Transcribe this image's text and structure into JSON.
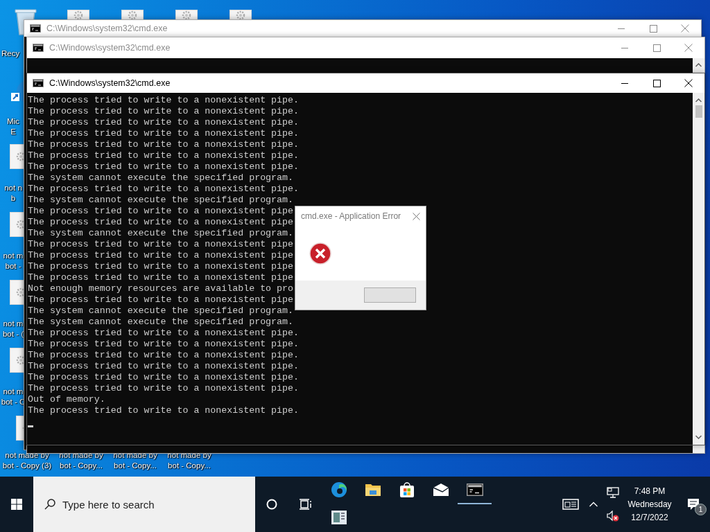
{
  "desktop": {
    "left_icons": [
      {
        "kind": "recycle",
        "label_lines": [
          "Recy"
        ]
      },
      {
        "kind": "edge",
        "label_lines": [
          "Mic",
          "E"
        ]
      },
      {
        "kind": "file",
        "label_lines": [
          "not n",
          "b"
        ]
      },
      {
        "kind": "file",
        "label_lines": [
          "not m",
          "bot -"
        ]
      },
      {
        "kind": "file",
        "label_lines": [
          "not m",
          "bot - ("
        ]
      },
      {
        "kind": "file",
        "label_lines": [
          "not m",
          "bot - C"
        ]
      }
    ],
    "top_icons": [
      {
        "kind": "file"
      },
      {
        "kind": "file"
      },
      {
        "kind": "file"
      },
      {
        "kind": "file"
      }
    ],
    "bottom_icons": [
      {
        "kind": "file",
        "label_lines": [
          "not made by",
          "bot - Copy (3)"
        ]
      },
      {
        "kind": "hidden",
        "label_lines": [
          "not made by",
          "bot - Copy..."
        ]
      },
      {
        "kind": "hidden",
        "label_lines": [
          "not made by",
          "bot - Copy..."
        ]
      },
      {
        "kind": "hidden",
        "label_lines": [
          "not made by",
          "bot - Copy..."
        ]
      }
    ]
  },
  "windows": [
    {
      "title": "C:\\Windows\\system32\\cmd.exe",
      "active": false
    },
    {
      "title": "C:\\Windows\\system32\\cmd.exe",
      "active": false
    },
    {
      "title": "C:\\Windows\\system32\\cmd.exe",
      "active": true,
      "lines": [
        "The process tried to write to a nonexistent pipe.",
        "The process tried to write to a nonexistent pipe.",
        "The process tried to write to a nonexistent pipe.",
        "The process tried to write to a nonexistent pipe.",
        "The process tried to write to a nonexistent pipe.",
        "The process tried to write to a nonexistent pipe.",
        "The process tried to write to a nonexistent pipe.",
        "The system cannot execute the specified program.",
        "The process tried to write to a nonexistent pipe.",
        "The system cannot execute the specified program.",
        "The process tried to write to a nonexistent pipe",
        "The process tried to write to a nonexistent pipe",
        "The system cannot execute the specified program.",
        "The process tried to write to a nonexistent pipe",
        "The process tried to write to a nonexistent pipe",
        "The process tried to write to a nonexistent pipe",
        "The process tried to write to a nonexistent pipe",
        "Not enough memory resources are available to pro",
        "The process tried to write to a nonexistent pipe",
        "The system cannot execute the specified program.",
        "The system cannot execute the specified program.",
        "The process tried to write to a nonexistent pipe.",
        "The process tried to write to a nonexistent pipe.",
        "The process tried to write to a nonexistent pipe.",
        "The process tried to write to a nonexistent pipe.",
        "The process tried to write to a nonexistent pipe.",
        "The process tried to write to a nonexistent pipe.",
        "Out of memory.",
        "The process tried to write to a nonexistent pipe."
      ]
    }
  ],
  "dialog": {
    "title": "cmd.exe - Application Error"
  },
  "taskbar": {
    "search": {
      "placeholder": "Type here to search"
    },
    "apps": [
      {
        "kind": "edge",
        "selected": false
      },
      {
        "kind": "explorer",
        "selected": false
      },
      {
        "kind": "store",
        "selected": false
      },
      {
        "kind": "mail",
        "selected": false
      },
      {
        "kind": "cmd",
        "selected": true
      }
    ],
    "apps_second_row": [
      {
        "kind": "news",
        "selected": false
      }
    ],
    "tray": {
      "volume_muted": true,
      "time": "7:48 PM",
      "day": "Wednesday",
      "date": "12/7/2022",
      "notification_count": "1"
    }
  }
}
